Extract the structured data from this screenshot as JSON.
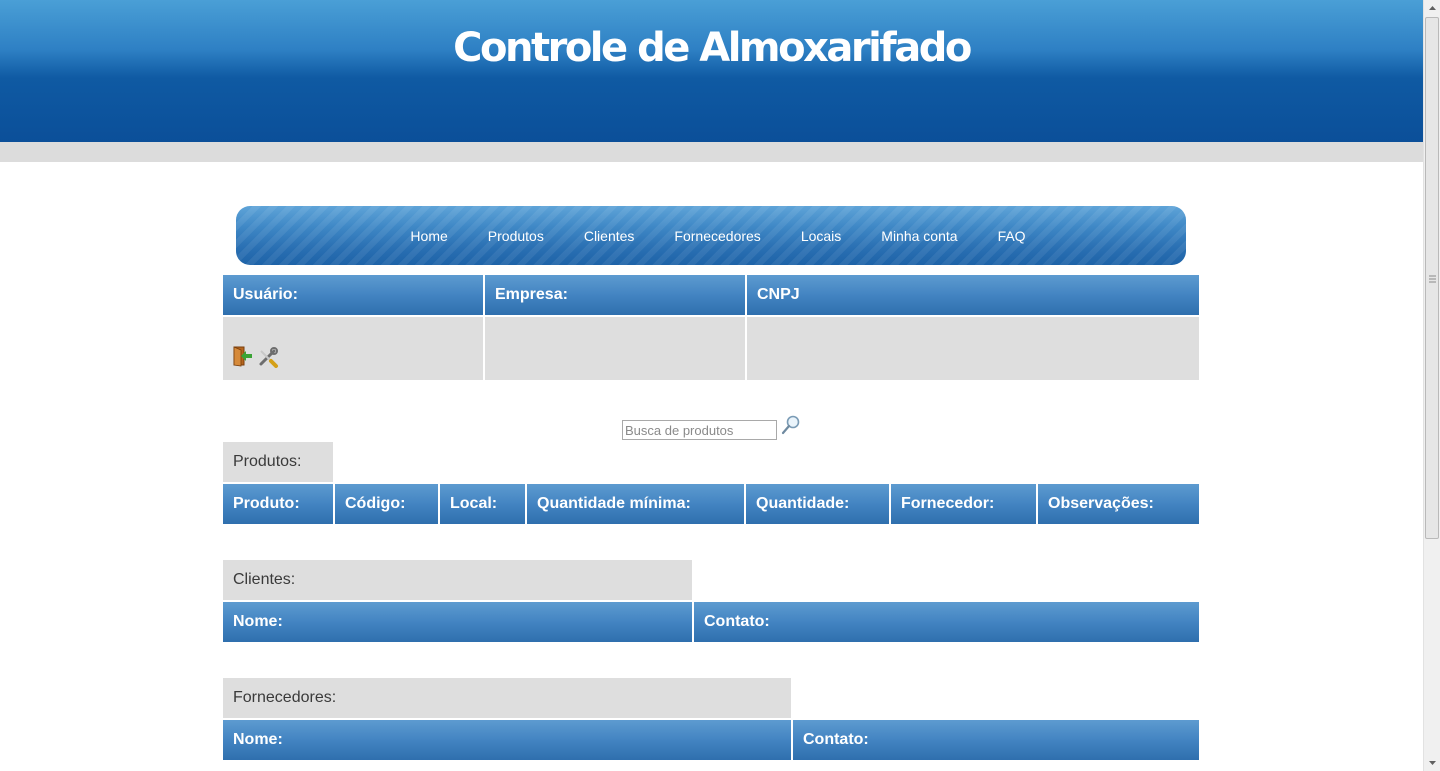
{
  "header": {
    "title": "Controle de Almoxarifado"
  },
  "nav": {
    "items": [
      "Home",
      "Produtos",
      "Clientes",
      "Fornecedores",
      "Locais",
      "Minha conta",
      "FAQ"
    ]
  },
  "user_table": {
    "headers": [
      "Usuário:",
      "Empresa:",
      "CNPJ"
    ],
    "icons": [
      "logout-icon",
      "tools-icon"
    ]
  },
  "search": {
    "placeholder": "Busca de produtos",
    "value": "",
    "button_icon": "magnifier-icon"
  },
  "produtos": {
    "label": "Produtos:",
    "headers": [
      "Produto:",
      "Código:",
      "Local:",
      "Quantidade mínima:",
      "Quantidade:",
      "Fornecedor:",
      "Observações:"
    ]
  },
  "clientes": {
    "label": "Clientes:",
    "headers": [
      "Nome:",
      "Contato:"
    ]
  },
  "fornecedores": {
    "label": "Fornecedores:",
    "headers": [
      "Nome:",
      "Contato:"
    ]
  },
  "colors": {
    "header_blue": "#0b4f99",
    "table_header_blue": "#4384c2",
    "cell_gray": "#dedede"
  }
}
